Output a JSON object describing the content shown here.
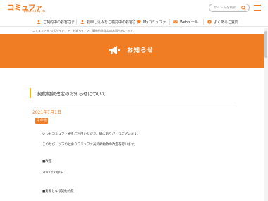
{
  "header": {
    "logo_text": "コミュファ",
    "logo_sub": "powered by ctc",
    "search_placeholder": "サイト内を検索",
    "brand_color": "#f07c24"
  },
  "gnav": {
    "items": [
      {
        "label": "ご契約中のお客さま",
        "icon": "user-icon"
      },
      {
        "label": "お申し込みをご検討中のお客さま",
        "icon": "user-icon"
      },
      {
        "label": "Myコミュファ",
        "icon": "heart-icon"
      },
      {
        "label": "Webメール",
        "icon": "mail-icon"
      },
      {
        "label": "よくあるご質問",
        "icon": "question-icon"
      }
    ]
  },
  "breadcrumb": [
    "コミュファ光 公式サイト",
    ">",
    "お知らせ",
    ">",
    "解約約款改定のお知らせについて"
  ],
  "hero": {
    "title": "お知らせ",
    "icon": "megaphone-icon"
  },
  "article": {
    "title": "契約約款改定のお知らせについて",
    "date": "2021年7月1日",
    "badge": "その他",
    "paragraphs": [
      "いつもコミュファ光をご利用いただき、誠にありがとうございます。",
      "このたび、以下のとおりコミュファ光契約約款の改定を行います。",
      "■改定",
      "2021年7月1日",
      "■対象となる契約約款"
    ]
  }
}
